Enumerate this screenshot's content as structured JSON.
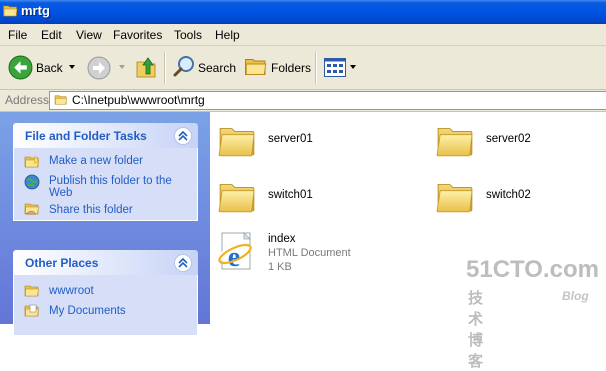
{
  "window": {
    "title": "mrtg"
  },
  "menu": [
    "File",
    "Edit",
    "View",
    "Favorites",
    "Tools",
    "Help"
  ],
  "toolbar": {
    "back_label": "Back",
    "search_label": "Search",
    "folders_label": "Folders"
  },
  "address": {
    "label": "Address",
    "path": "C:\\Inetpub\\wwwroot\\mrtg"
  },
  "tasks": {
    "title": "File and Folder Tasks",
    "items": [
      {
        "label": "Make a new folder",
        "icon": "new-folder-icon"
      },
      {
        "label": "Publish this folder to the Web",
        "icon": "publish-web-icon"
      },
      {
        "label": "Share this folder",
        "icon": "share-folder-icon"
      }
    ]
  },
  "other_places": {
    "title": "Other Places",
    "items": [
      {
        "label": "wwwroot",
        "icon": "folder-icon"
      },
      {
        "label": "My Documents",
        "icon": "my-documents-icon"
      }
    ]
  },
  "files": [
    {
      "name": "server01",
      "type": "folder"
    },
    {
      "name": "server02",
      "type": "folder"
    },
    {
      "name": "switch01",
      "type": "folder"
    },
    {
      "name": "switch02",
      "type": "folder"
    },
    {
      "name": "index",
      "type": "HTML Document",
      "size": "1 KB"
    }
  ],
  "watermark": {
    "line1": "51CTO.com",
    "line2": "技术博客",
    "line3": "Blog"
  },
  "colors": {
    "titlebar": "#0054e3",
    "task_link": "#215dc6",
    "pane_bg": "#6375d6",
    "folder": "#f5d66e"
  }
}
